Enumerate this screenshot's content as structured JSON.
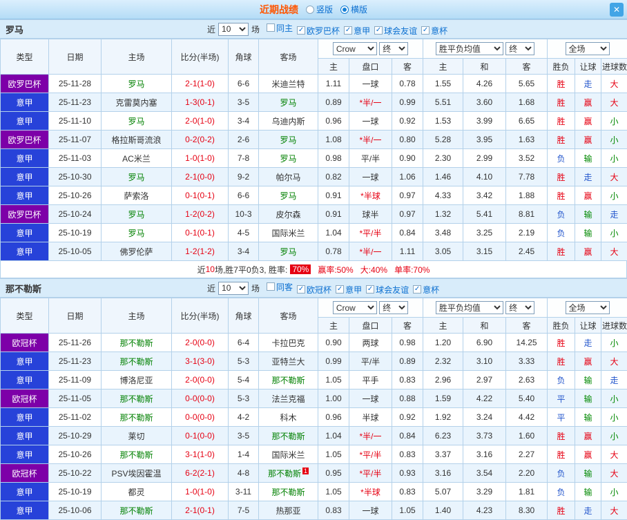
{
  "titlebar": {
    "title": "近期战绩",
    "layout_options": [
      {
        "label": "竖版",
        "selected": false
      },
      {
        "label": "横版",
        "selected": true
      }
    ],
    "close_label": "✕"
  },
  "filter": {
    "near": "近",
    "count": "10",
    "games": "场"
  },
  "selects": {
    "bookmaker": "Crow",
    "final_a": "终",
    "avg": "胜平负均值",
    "final_b": "终",
    "scope": "全场"
  },
  "table_headers": {
    "type": "类型",
    "date": "日期",
    "home": "主场",
    "score": "比分(半场)",
    "corner": "角球",
    "away": "客场",
    "sub": [
      "主",
      "盘口",
      "客",
      "主",
      "和",
      "客",
      "胜负",
      "让球",
      "进球数"
    ]
  },
  "colors": {
    "league": {
      "欧罗巴杯": "#7d00a8",
      "欧冠杯": "#7d00a8",
      "意甲": "#2742d9"
    },
    "focal_team": "#008000",
    "score": "#e60012",
    "handicap_star": "#e60012",
    "outcome": {
      "胜": "#e60012",
      "平": "#2255cc",
      "负": "#2255cc",
      "赢": "#e60012",
      "走": "#2255cc",
      "输": "#008800",
      "大": "#e60012",
      "小": "#008800"
    }
  },
  "sections": [
    {
      "team": "罗马",
      "checkboxes": [
        {
          "label": "同主",
          "checked": false
        },
        {
          "label": "欧罗巴杯",
          "checked": true
        },
        {
          "label": "意甲",
          "checked": true
        },
        {
          "label": "球会友谊",
          "checked": true
        },
        {
          "label": "意杯",
          "checked": true
        }
      ],
      "rows": [
        {
          "league": "欧罗巴杯",
          "date": "25-11-28",
          "home": "罗马",
          "home_focal": true,
          "score": "2-1(1-0)",
          "corners": "6-6",
          "away": "米迪兰特",
          "away_focal": false,
          "ah_home": "1.11",
          "handicap": "一球",
          "ah_away": "0.78",
          "eu_home": "1.55",
          "eu_draw": "4.26",
          "eu_away": "5.65",
          "result": "胜",
          "let": "走",
          "ou": "大"
        },
        {
          "league": "意甲",
          "date": "25-11-23",
          "home": "克雷莫内塞",
          "home_focal": false,
          "score": "1-3(0-1)",
          "corners": "3-5",
          "away": "罗马",
          "away_focal": true,
          "ah_home": "0.89",
          "handicap": "*半/一",
          "ah_away": "0.99",
          "eu_home": "5.51",
          "eu_draw": "3.60",
          "eu_away": "1.68",
          "result": "胜",
          "let": "赢",
          "ou": "大"
        },
        {
          "league": "意甲",
          "date": "25-11-10",
          "home": "罗马",
          "home_focal": true,
          "score": "2-0(1-0)",
          "corners": "3-4",
          "away": "乌迪内斯",
          "away_focal": false,
          "ah_home": "0.96",
          "handicap": "一球",
          "ah_away": "0.92",
          "eu_home": "1.53",
          "eu_draw": "3.99",
          "eu_away": "6.65",
          "result": "胜",
          "let": "赢",
          "ou": "小"
        },
        {
          "league": "欧罗巴杯",
          "date": "25-11-07",
          "home": "格拉斯哥流浪",
          "home_focal": false,
          "score": "0-2(0-2)",
          "corners": "2-6",
          "away": "罗马",
          "away_focal": true,
          "ah_home": "1.08",
          "handicap": "*半/一",
          "ah_away": "0.80",
          "eu_home": "5.28",
          "eu_draw": "3.95",
          "eu_away": "1.63",
          "result": "胜",
          "let": "赢",
          "ou": "小"
        },
        {
          "league": "意甲",
          "date": "25-11-03",
          "home": "AC米兰",
          "home_focal": false,
          "score": "1-0(1-0)",
          "corners": "7-8",
          "away": "罗马",
          "away_focal": true,
          "ah_home": "0.98",
          "handicap": "平/半",
          "ah_away": "0.90",
          "eu_home": "2.30",
          "eu_draw": "2.99",
          "eu_away": "3.52",
          "result": "负",
          "let": "输",
          "ou": "小"
        },
        {
          "league": "意甲",
          "date": "25-10-30",
          "home": "罗马",
          "home_focal": true,
          "score": "2-1(0-0)",
          "corners": "9-2",
          "away": "帕尔马",
          "away_focal": false,
          "ah_home": "0.82",
          "handicap": "一球",
          "ah_away": "1.06",
          "eu_home": "1.46",
          "eu_draw": "4.10",
          "eu_away": "7.78",
          "result": "胜",
          "let": "走",
          "ou": "大"
        },
        {
          "league": "意甲",
          "date": "25-10-26",
          "home": "萨索洛",
          "home_focal": false,
          "score": "0-1(0-1)",
          "corners": "6-6",
          "away": "罗马",
          "away_focal": true,
          "ah_home": "0.91",
          "handicap": "*半球",
          "ah_away": "0.97",
          "eu_home": "4.33",
          "eu_draw": "3.42",
          "eu_away": "1.88",
          "result": "胜",
          "let": "赢",
          "ou": "小"
        },
        {
          "league": "欧罗巴杯",
          "date": "25-10-24",
          "home": "罗马",
          "home_focal": true,
          "score": "1-2(0-2)",
          "corners": "10-3",
          "away": "皮尔森",
          "away_focal": false,
          "ah_home": "0.91",
          "handicap": "球半",
          "ah_away": "0.97",
          "eu_home": "1.32",
          "eu_draw": "5.41",
          "eu_away": "8.81",
          "result": "负",
          "let": "输",
          "ou": "走"
        },
        {
          "league": "意甲",
          "date": "25-10-19",
          "home": "罗马",
          "home_focal": true,
          "score": "0-1(0-1)",
          "corners": "4-5",
          "away": "国际米兰",
          "away_focal": false,
          "ah_home": "1.04",
          "handicap": "*平/半",
          "ah_away": "0.84",
          "eu_home": "3.48",
          "eu_draw": "3.25",
          "eu_away": "2.19",
          "result": "负",
          "let": "输",
          "ou": "小"
        },
        {
          "league": "意甲",
          "date": "25-10-05",
          "home": "佛罗伦萨",
          "home_focal": false,
          "score": "1-2(1-2)",
          "corners": "3-4",
          "away": "罗马",
          "away_focal": true,
          "ah_home": "0.78",
          "handicap": "*半/一",
          "ah_away": "1.11",
          "eu_home": "3.05",
          "eu_draw": "3.15",
          "eu_away": "2.45",
          "result": "胜",
          "let": "赢",
          "ou": "大"
        }
      ],
      "summary": {
        "prefix": "近",
        "count": "10",
        "middle": "场,胜7平0负3, 胜率:",
        "badge": "70%",
        "tail": [
          "赢率:50%",
          "大:40%",
          "单率:70%"
        ]
      }
    },
    {
      "team": "那不勒斯",
      "checkboxes": [
        {
          "label": "同客",
          "checked": false
        },
        {
          "label": "欧冠杯",
          "checked": true
        },
        {
          "label": "意甲",
          "checked": true
        },
        {
          "label": "球会友谊",
          "checked": true
        },
        {
          "label": "意杯",
          "checked": true
        }
      ],
      "rows": [
        {
          "league": "欧冠杯",
          "date": "25-11-26",
          "home": "那不勒斯",
          "home_focal": true,
          "score": "2-0(0-0)",
          "corners": "6-4",
          "away": "卡拉巴克",
          "away_focal": false,
          "ah_home": "0.90",
          "handicap": "两球",
          "ah_away": "0.98",
          "eu_home": "1.20",
          "eu_draw": "6.90",
          "eu_away": "14.25",
          "result": "胜",
          "let": "走",
          "ou": "小"
        },
        {
          "league": "意甲",
          "date": "25-11-23",
          "home": "那不勒斯",
          "home_focal": true,
          "score": "3-1(3-0)",
          "corners": "5-3",
          "away": "亚特兰大",
          "away_focal": false,
          "ah_home": "0.99",
          "handicap": "平/半",
          "ah_away": "0.89",
          "eu_home": "2.32",
          "eu_draw": "3.10",
          "eu_away": "3.33",
          "result": "胜",
          "let": "赢",
          "ou": "大"
        },
        {
          "league": "意甲",
          "date": "25-11-09",
          "home": "博洛尼亚",
          "home_focal": false,
          "score": "2-0(0-0)",
          "corners": "5-4",
          "away": "那不勒斯",
          "away_focal": true,
          "ah_home": "1.05",
          "handicap": "平手",
          "ah_away": "0.83",
          "eu_home": "2.96",
          "eu_draw": "2.97",
          "eu_away": "2.63",
          "result": "负",
          "let": "输",
          "ou": "走"
        },
        {
          "league": "欧冠杯",
          "date": "25-11-05",
          "home": "那不勒斯",
          "home_focal": true,
          "score": "0-0(0-0)",
          "corners": "5-3",
          "away": "法兰克福",
          "away_focal": false,
          "ah_home": "1.00",
          "handicap": "一球",
          "ah_away": "0.88",
          "eu_home": "1.59",
          "eu_draw": "4.22",
          "eu_away": "5.40",
          "result": "平",
          "let": "输",
          "ou": "小"
        },
        {
          "league": "意甲",
          "date": "25-11-02",
          "home": "那不勒斯",
          "home_focal": true,
          "score": "0-0(0-0)",
          "corners": "4-2",
          "away": "科木",
          "away_focal": false,
          "ah_home": "0.96",
          "handicap": "半球",
          "ah_away": "0.92",
          "eu_home": "1.92",
          "eu_draw": "3.24",
          "eu_away": "4.42",
          "result": "平",
          "let": "输",
          "ou": "小"
        },
        {
          "league": "意甲",
          "date": "25-10-29",
          "home": "莱切",
          "home_focal": false,
          "score": "0-1(0-0)",
          "corners": "3-5",
          "away": "那不勒斯",
          "away_focal": true,
          "ah_home": "1.04",
          "handicap": "*半/一",
          "ah_away": "0.84",
          "eu_home": "6.23",
          "eu_draw": "3.73",
          "eu_away": "1.60",
          "result": "胜",
          "let": "赢",
          "ou": "小"
        },
        {
          "league": "意甲",
          "date": "25-10-26",
          "home": "那不勒斯",
          "home_focal": true,
          "score": "3-1(1-0)",
          "corners": "1-4",
          "away": "国际米兰",
          "away_focal": false,
          "ah_home": "1.05",
          "handicap": "*平/半",
          "ah_away": "0.83",
          "eu_home": "3.37",
          "eu_draw": "3.16",
          "eu_away": "2.27",
          "result": "胜",
          "let": "赢",
          "ou": "大"
        },
        {
          "league": "欧冠杯",
          "date": "25-10-22",
          "home": "PSV埃因霍温",
          "home_focal": false,
          "score": "6-2(2-1)",
          "corners": "4-8",
          "away": "那不勒斯",
          "away_focal": true,
          "away_badge": "1",
          "ah_home": "0.95",
          "handicap": "*平/半",
          "ah_away": "0.93",
          "eu_home": "3.16",
          "eu_draw": "3.54",
          "eu_away": "2.20",
          "result": "负",
          "let": "输",
          "ou": "大"
        },
        {
          "league": "意甲",
          "date": "25-10-19",
          "home": "都灵",
          "home_focal": false,
          "score": "1-0(1-0)",
          "corners": "3-11",
          "away": "那不勒斯",
          "away_focal": true,
          "ah_home": "1.05",
          "handicap": "*半球",
          "ah_away": "0.83",
          "eu_home": "5.07",
          "eu_draw": "3.29",
          "eu_away": "1.81",
          "result": "负",
          "let": "输",
          "ou": "小"
        },
        {
          "league": "意甲",
          "date": "25-10-06",
          "home": "那不勒斯",
          "home_focal": true,
          "score": "2-1(0-1)",
          "corners": "7-5",
          "away": "热那亚",
          "away_focal": false,
          "ah_home": "0.83",
          "handicap": "一球",
          "ah_away": "1.05",
          "eu_home": "1.40",
          "eu_draw": "4.23",
          "eu_away": "8.30",
          "result": "胜",
          "let": "走",
          "ou": "大"
        }
      ],
      "summary": null
    }
  ]
}
